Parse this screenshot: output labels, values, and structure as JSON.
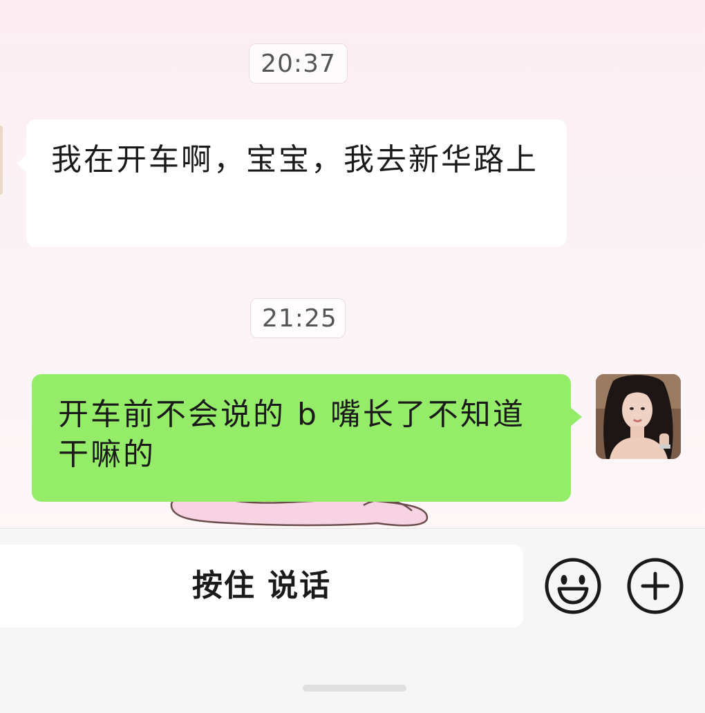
{
  "chat": {
    "messages": [
      {
        "time": "20:37",
        "direction": "received",
        "text": "我在开车啊，宝宝，我去新华路上"
      },
      {
        "time": "21:25",
        "direction": "sent",
        "text": "开车前不会说的 b 嘴长了不知道干嘛的"
      }
    ],
    "sent_bubble_color": "#95ec69",
    "received_bubble_color": "#ffffff"
  },
  "input_bar": {
    "hold_to_talk_label": "按住 说话",
    "emoji_icon": "emoji-smile-icon",
    "plus_icon": "plus-circle-icon"
  }
}
